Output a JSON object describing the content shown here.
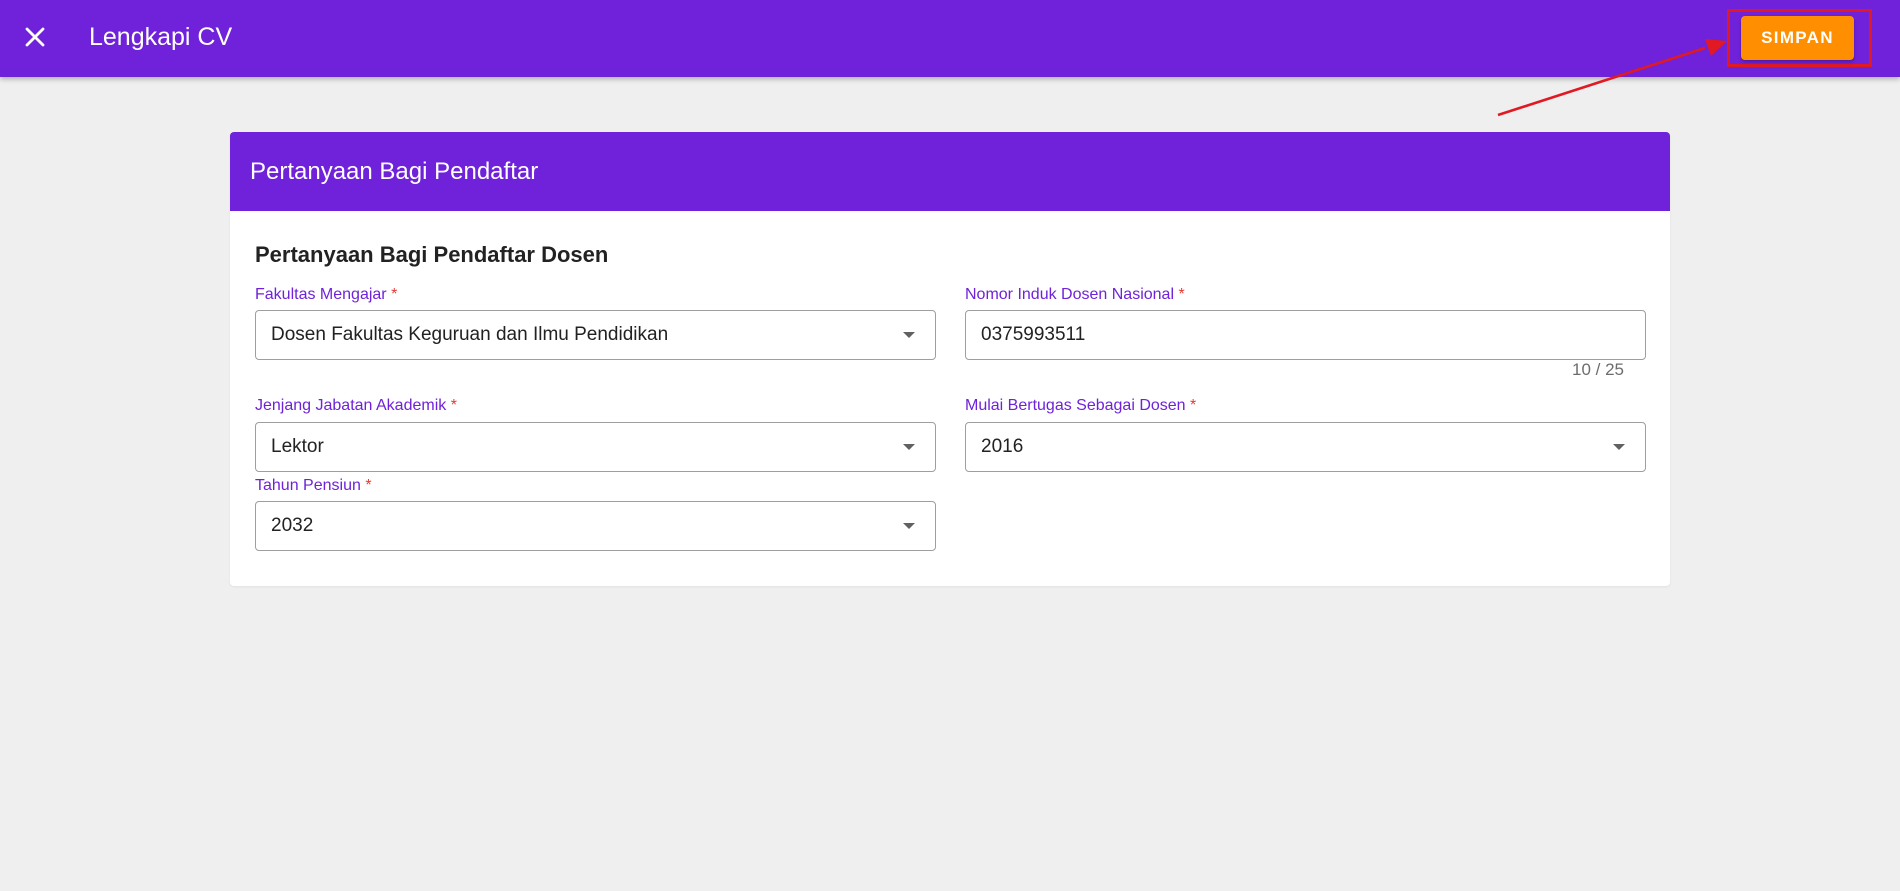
{
  "appbar": {
    "title": "Lengkapi CV",
    "close_icon": "close-icon",
    "save_label": "SIMPAN"
  },
  "card": {
    "header": "Pertanyaan Bagi Pendaftar",
    "section_title": "Pertanyaan Bagi Pendaftar Dosen",
    "fields": {
      "fakultas": {
        "label": "Fakultas Mengajar",
        "required_mark": "*",
        "value": "Dosen Fakultas Keguruan dan Ilmu Pendidikan"
      },
      "nidn": {
        "label": "Nomor Induk Dosen Nasional",
        "required_mark": "*",
        "value": "0375993511",
        "counter": "10 / 25"
      },
      "jabatan": {
        "label": "Jenjang Jabatan Akademik",
        "required_mark": "*",
        "value": "Lektor"
      },
      "mulai": {
        "label": "Mulai Bertugas Sebagai Dosen",
        "required_mark": "*",
        "value": "2016"
      },
      "pensiun": {
        "label": "Tahun Pensiun",
        "required_mark": "*",
        "value": "2032"
      }
    }
  },
  "colors": {
    "primary": "#6f22d9",
    "accent": "#ff8f00",
    "highlight": "#e01923",
    "background": "#efefef",
    "required": "#e53935"
  }
}
